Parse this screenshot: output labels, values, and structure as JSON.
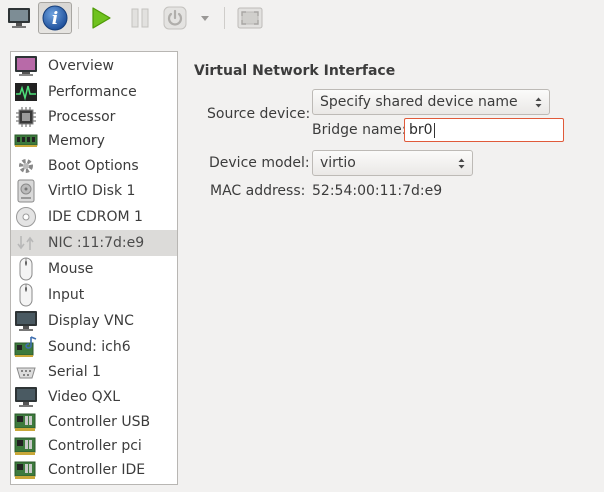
{
  "toolbar": {
    "buttons": [
      {
        "name": "console",
        "icon": "monitor-icon"
      },
      {
        "name": "details",
        "icon": "info-icon",
        "active": true
      },
      {
        "name": "run",
        "icon": "play-icon"
      },
      {
        "name": "pause",
        "icon": "pause-icon"
      },
      {
        "name": "shutdown",
        "icon": "power-icon"
      },
      {
        "name": "shutdown-menu",
        "icon": "chevron-down-icon"
      },
      {
        "name": "fullscreen",
        "icon": "fullscreen-icon"
      }
    ]
  },
  "sidebar": {
    "selected_index": 7,
    "items": [
      {
        "label": "Overview",
        "icon": "monitor-icon"
      },
      {
        "label": "Performance",
        "icon": "performance-icon"
      },
      {
        "label": "Processor",
        "icon": "cpu-icon"
      },
      {
        "label": "Memory",
        "icon": "memory-icon"
      },
      {
        "label": "Boot Options",
        "icon": "boot-options-icon"
      },
      {
        "label": "VirtIO Disk 1",
        "icon": "disk-icon"
      },
      {
        "label": "IDE CDROM 1",
        "icon": "cdrom-icon"
      },
      {
        "label": "NIC :11:7d:e9",
        "icon": "network-icon"
      },
      {
        "label": "Mouse",
        "icon": "mouse-icon"
      },
      {
        "label": "Input",
        "icon": "input-icon"
      },
      {
        "label": "Display VNC",
        "icon": "display-icon"
      },
      {
        "label": "Sound: ich6",
        "icon": "sound-icon"
      },
      {
        "label": "Serial 1",
        "icon": "serial-icon"
      },
      {
        "label": "Video QXL",
        "icon": "video-icon"
      },
      {
        "label": "Controller USB",
        "icon": "controller-icon"
      },
      {
        "label": "Controller pci",
        "icon": "controller-icon"
      },
      {
        "label": "Controller IDE",
        "icon": "controller-icon"
      }
    ]
  },
  "details": {
    "title": "Virtual Network Interface",
    "source_device": {
      "label": "Source device:",
      "value": "Specify shared device name"
    },
    "bridge_name": {
      "label": "Bridge name:",
      "value": "br0"
    },
    "device_model": {
      "label": "Device model:",
      "value": "virtio"
    },
    "mac_address": {
      "label": "MAC address:",
      "value": "52:54:00:11:7d:e9"
    }
  },
  "colors": {
    "window_bg": "#f2f1f0",
    "selection_bg": "#dcdbd9",
    "focus_border": "#e05a3a",
    "run_green": "#6fc21e"
  }
}
